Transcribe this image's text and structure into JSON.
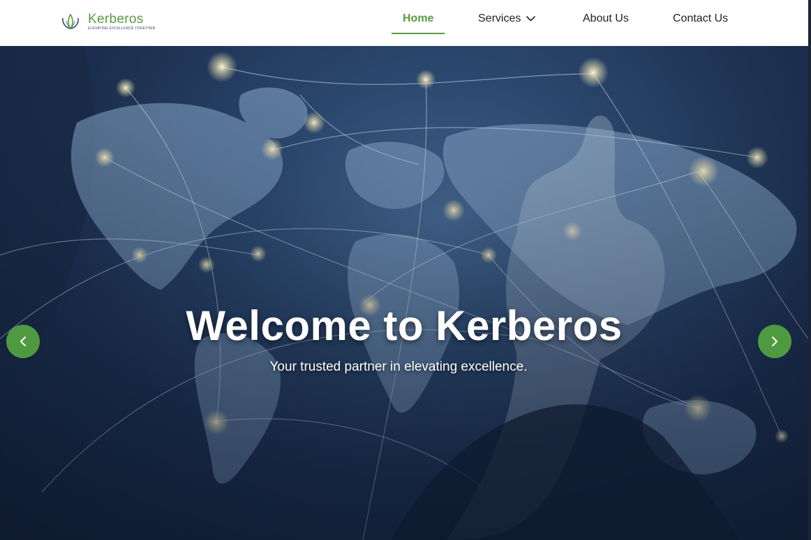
{
  "brand": {
    "name": "Kerberos",
    "tagline": "ELEVATING EXCELLENCE TOGETHER",
    "primary_color": "#5a9a42",
    "logo_icon": "lotus-logo-icon"
  },
  "nav": {
    "items": [
      {
        "label": "Home",
        "active": true
      },
      {
        "label": "Services",
        "has_dropdown": true
      },
      {
        "label": "About Us"
      },
      {
        "label": "Contact Us"
      }
    ],
    "dropdown_icon": "chevron-down-icon"
  },
  "hero": {
    "title": "Welcome to Kerberos",
    "subtitle": "Your trusted partner in elevating excellence.",
    "background": "world-map-network-image",
    "prev_icon": "chevron-left-icon",
    "next_icon": "chevron-right-icon",
    "button_color": "#4f9a40"
  }
}
